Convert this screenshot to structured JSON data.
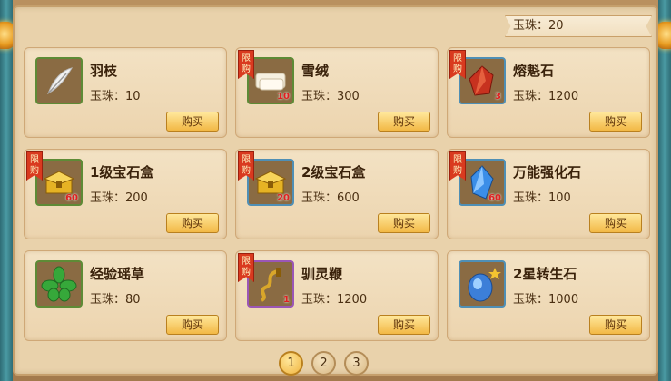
{
  "currency": {
    "label": "玉珠：",
    "value": "20"
  },
  "items": [
    {
      "name": "羽枝",
      "price_label": "玉珠：",
      "price": "10",
      "qty": "",
      "limited": false,
      "limit_label": "",
      "buy_label": "购买",
      "icon": "feather-icon",
      "frame": "green"
    },
    {
      "name": "雪绒",
      "price_label": "玉珠：",
      "price": "300",
      "qty": "10",
      "limited": true,
      "limit_label": "限购",
      "buy_label": "购买",
      "icon": "snow-velvet-icon",
      "frame": "green"
    },
    {
      "name": "熔魁石",
      "price_label": "玉珠：",
      "price": "1200",
      "qty": "3",
      "limited": true,
      "limit_label": "限购",
      "buy_label": "购买",
      "icon": "red-crystal-icon",
      "frame": "blue"
    },
    {
      "name": "1级宝石盒",
      "price_label": "玉珠：",
      "price": "200",
      "qty": "60",
      "limited": true,
      "limit_label": "限购",
      "buy_label": "购买",
      "icon": "gem-box-icon",
      "frame": "green"
    },
    {
      "name": "2级宝石盒",
      "price_label": "玉珠：",
      "price": "600",
      "qty": "20",
      "limited": true,
      "limit_label": "限购",
      "buy_label": "购买",
      "icon": "gem-box-icon",
      "frame": "blue"
    },
    {
      "name": "万能强化石",
      "price_label": "玉珠：",
      "price": "100",
      "qty": "60",
      "limited": true,
      "limit_label": "限购",
      "buy_label": "购买",
      "icon": "blue-crystal-icon",
      "frame": "blue"
    },
    {
      "name": "经验瑶草",
      "price_label": "玉珠：",
      "price": "80",
      "qty": "",
      "limited": false,
      "limit_label": "",
      "buy_label": "购买",
      "icon": "herb-icon",
      "frame": "green"
    },
    {
      "name": "驯灵鞭",
      "price_label": "玉珠：",
      "price": "1200",
      "qty": "1",
      "limited": true,
      "limit_label": "限购",
      "buy_label": "购买",
      "icon": "whip-icon",
      "frame": "purple"
    },
    {
      "name": "2星转生石",
      "price_label": "玉珠：",
      "price": "1000",
      "qty": "",
      "limited": false,
      "limit_label": "",
      "buy_label": "购买",
      "icon": "rebirth-stone-icon",
      "frame": "blue"
    }
  ],
  "pagination": {
    "pages": [
      "1",
      "2",
      "3"
    ],
    "current": "1"
  }
}
